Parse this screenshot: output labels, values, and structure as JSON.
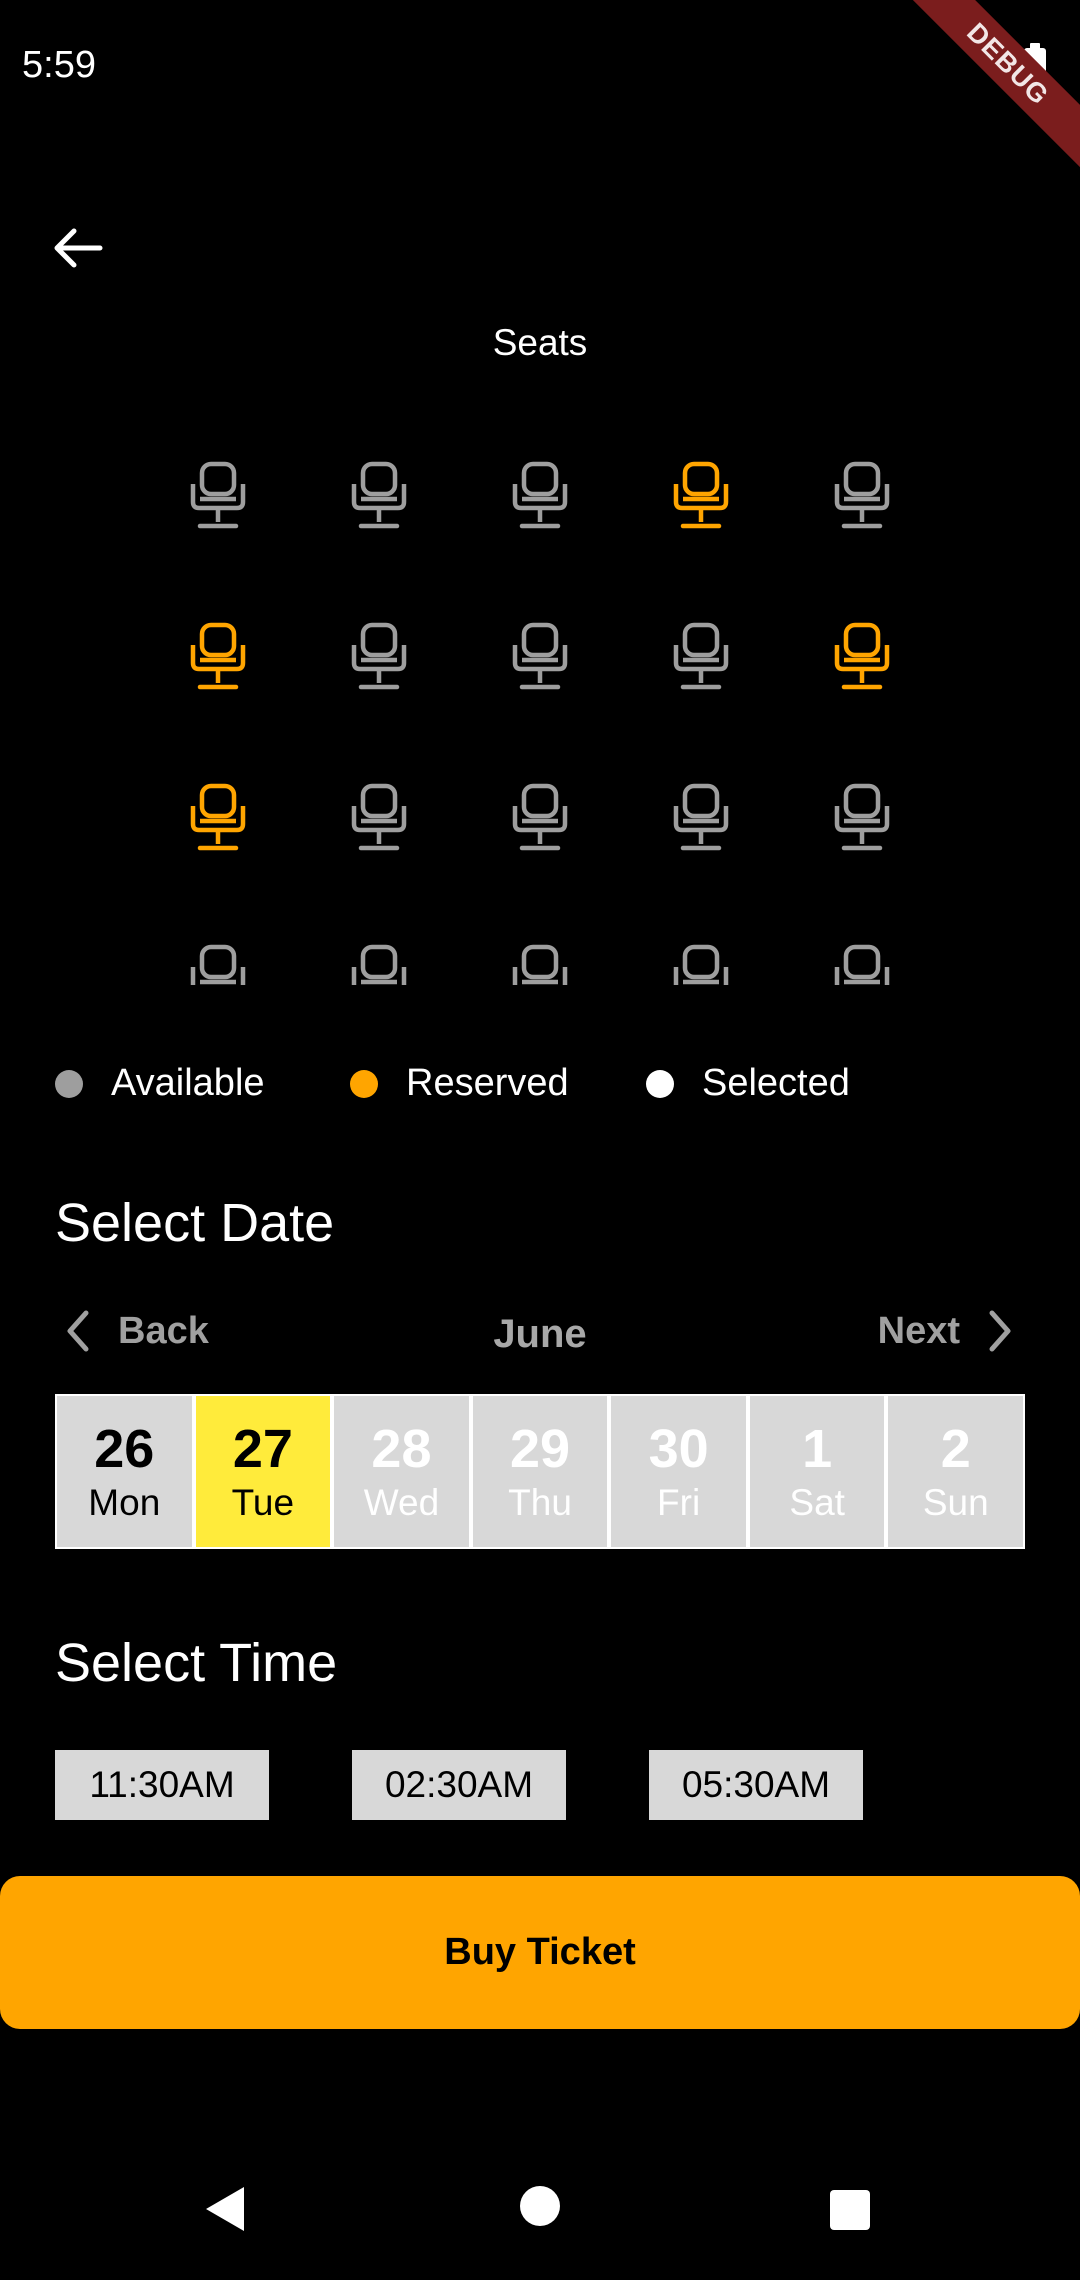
{
  "status_bar": {
    "time": "5:59",
    "debug_label": "DEBUG"
  },
  "header": {
    "title": "Seats"
  },
  "colors": {
    "available": "#9e9e9e",
    "reserved": "#ffa500",
    "selected": "#ffffff",
    "selected_date": "#ffeb3b",
    "buy_button": "#ffa500"
  },
  "seats": [
    [
      "available",
      "available",
      "available",
      "reserved",
      "available"
    ],
    [
      "reserved",
      "available",
      "available",
      "available",
      "reserved"
    ],
    [
      "reserved",
      "available",
      "available",
      "available",
      "available"
    ],
    [
      "available",
      "available",
      "available",
      "available",
      "available"
    ]
  ],
  "legend": [
    {
      "label": "Available",
      "color": "#9e9e9e"
    },
    {
      "label": "Reserved",
      "color": "#ffa500"
    },
    {
      "label": "Selected",
      "color": "#ffffff"
    }
  ],
  "date_section": {
    "title": "Select Date",
    "back_label": "Back",
    "next_label": "Next",
    "month": "June",
    "dates": [
      {
        "num": "26",
        "day": "Mon",
        "state": "past"
      },
      {
        "num": "27",
        "day": "Tue",
        "state": "selected"
      },
      {
        "num": "28",
        "day": "Wed",
        "state": "future"
      },
      {
        "num": "29",
        "day": "Thu",
        "state": "future"
      },
      {
        "num": "30",
        "day": "Fri",
        "state": "future"
      },
      {
        "num": "1",
        "day": "Sat",
        "state": "future"
      },
      {
        "num": "2",
        "day": "Sun",
        "state": "future"
      }
    ]
  },
  "time_section": {
    "title": "Select Time",
    "times": [
      "11:30AM",
      "02:30AM",
      "05:30AM"
    ]
  },
  "buy_button": {
    "label": "Buy Ticket"
  },
  "icons": {
    "back": "arrow-back-icon",
    "seat": "seat-icon",
    "chevron_left": "chevron-left-icon",
    "chevron_right": "chevron-right-icon",
    "nav_back": "triangle-back-icon",
    "nav_home": "circle-home-icon",
    "nav_recents": "square-recents-icon"
  }
}
